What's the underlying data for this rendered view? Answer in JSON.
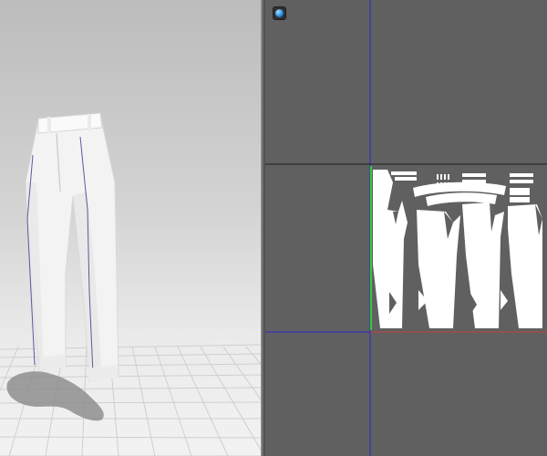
{
  "viewport_3d": {
    "background_top": "#bcbcbc",
    "background_bottom": "#f2f2f2",
    "garment": "pants",
    "garment_color": "#f4f4f4",
    "seam_color": "#5a58a0",
    "floor_grid_color": "#d0d0d0"
  },
  "viewport_2d": {
    "background": "#606060",
    "axis_vertical_color": "#2a2ac8",
    "axis_horizontal_color": "#1a1a1a",
    "boundary_color": "#2a2ac8",
    "pattern_color": "#ffffff",
    "pattern_edge_green": "#2ecc40",
    "pattern_edge_red": "#c04040",
    "mode_icon": "sphere-3d-icon"
  }
}
